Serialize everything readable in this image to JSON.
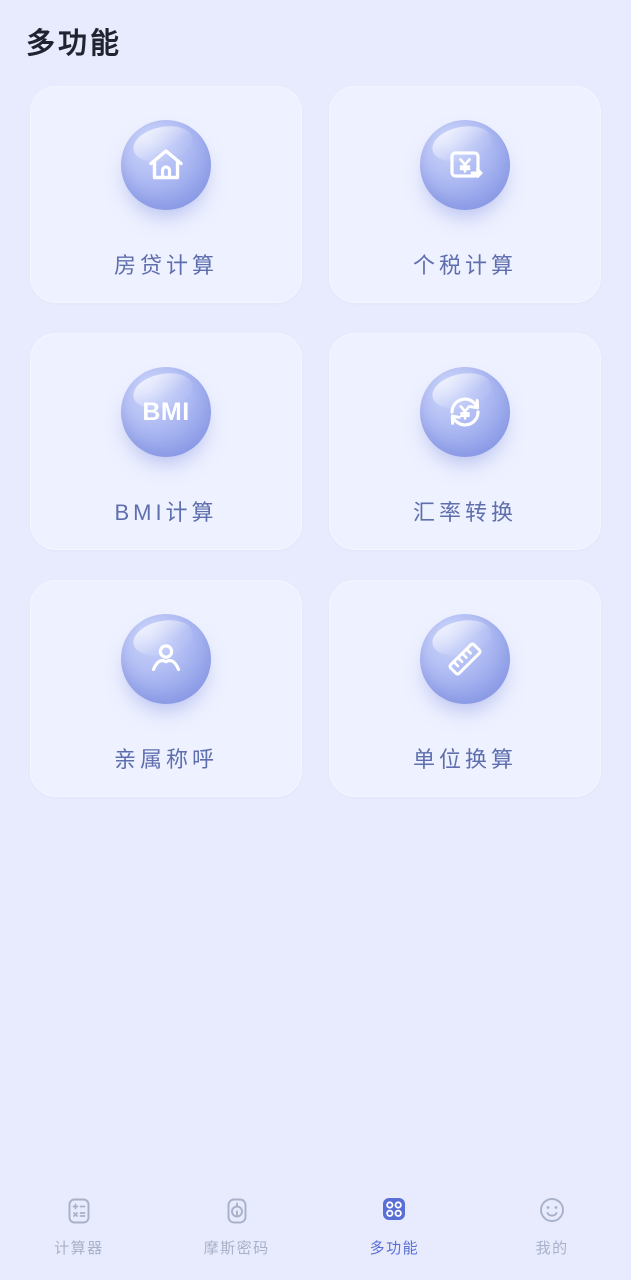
{
  "header": {
    "title": "多功能"
  },
  "colors": {
    "background": "#e7ebfd",
    "card_bg": "#eef1ff",
    "card_label": "#5f6fae",
    "orb_light": "#cdd6fb",
    "orb_dark": "#8a9ae8",
    "tab_active": "#5a6fd6",
    "tab_inactive": "#a9b1ca",
    "title": "#1f2430"
  },
  "grid": {
    "items": [
      {
        "label": "房贷计算",
        "icon": "house-icon"
      },
      {
        "label": "个税计算",
        "icon": "yuan-box-arrow-icon"
      },
      {
        "label": "BMI计算",
        "icon": "bmi-text-icon",
        "icon_text": "BMI"
      },
      {
        "label": "汇率转换",
        "icon": "currency-exchange-icon"
      },
      {
        "label": "亲属称呼",
        "icon": "person-icon"
      },
      {
        "label": "单位换算",
        "icon": "ruler-icon"
      }
    ]
  },
  "tabbar": {
    "items": [
      {
        "label": "计算器",
        "icon": "calculator-icon",
        "active": false
      },
      {
        "label": "摩斯密码",
        "icon": "lock-icon",
        "active": false
      },
      {
        "label": "多功能",
        "icon": "grid-apps-icon",
        "active": true
      },
      {
        "label": "我的",
        "icon": "smiley-face-icon",
        "active": false
      }
    ]
  }
}
